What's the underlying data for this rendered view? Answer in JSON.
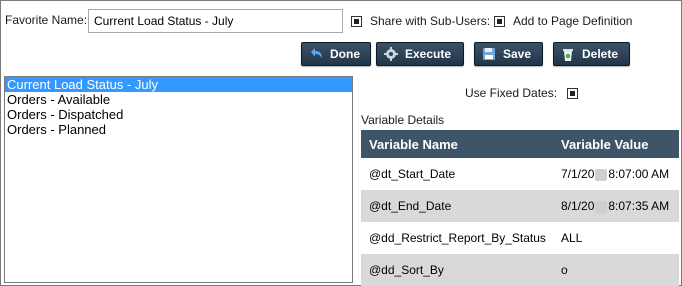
{
  "form": {
    "favorite_label": "Favorite Name:",
    "favorite_value": "Current Load Status - July",
    "share_label": "Share with Sub-Users:",
    "page_def_label": "Add to Page Definition"
  },
  "toolbar": {
    "done_label": "Done",
    "execute_label": "Execute",
    "save_label": "Save",
    "delete_label": "Delete"
  },
  "favorites": [
    "Current Load Status - July",
    "Orders - Available",
    "Orders - Dispatched",
    "Orders - Planned"
  ],
  "fixed_dates_label": "Use Fixed Dates:",
  "variable_details": {
    "title": "Variable Details",
    "headers": [
      "Variable Name",
      "Variable Value"
    ],
    "rows": [
      {
        "name": "@dt_Start_Date",
        "value_prefix": "7/1/20",
        "value_suffix": "8:07:00 AM"
      },
      {
        "name": "@dt_End_Date",
        "value_prefix": "8/1/20",
        "value_suffix": "8:07:35 AM"
      },
      {
        "name": "@dd_Restrict_Report_By_Status",
        "value_prefix": "ALL",
        "value_suffix": ""
      },
      {
        "name": "@dd_Sort_By",
        "value_prefix": "o",
        "value_suffix": ""
      }
    ]
  },
  "colors": {
    "button_bg": "#2f4459",
    "header_bg": "#3e5469",
    "selection_bg": "#3399ff",
    "alt_row_bg": "#d9d9d9"
  }
}
